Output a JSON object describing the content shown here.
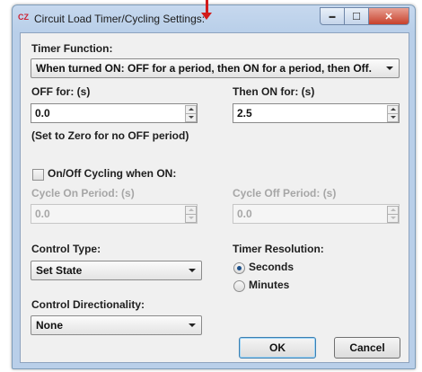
{
  "window": {
    "app_icon": "CZ",
    "title": "Circuit Load Timer/Cycling Settings:"
  },
  "title_buttons": {
    "minimize": "▬",
    "maximize": "☐",
    "close": "✕"
  },
  "timer_function": {
    "label": "Timer Function:",
    "value": "When turned ON: OFF for a period, then ON for a period, then Off."
  },
  "off_for": {
    "label": "OFF for: (s)",
    "value": "0.0",
    "hint": "(Set to Zero for no OFF period)"
  },
  "then_on_for": {
    "label": "Then ON for: (s)",
    "value": "2.5"
  },
  "cycling": {
    "label": "On/Off Cycling when ON:",
    "checked": false
  },
  "cycle_on": {
    "label": "Cycle On Period: (s)",
    "value": "0.0"
  },
  "cycle_off": {
    "label": "Cycle Off Period: (s)",
    "value": "0.0"
  },
  "control_type": {
    "label": "Control Type:",
    "value": "Set State"
  },
  "timer_resolution": {
    "label": "Timer Resolution:",
    "options": [
      "Seconds",
      "Minutes"
    ],
    "selected": "Seconds"
  },
  "control_directionality": {
    "label": "Control Directionality:",
    "value": "None"
  },
  "buttons": {
    "ok": "OK",
    "cancel": "Cancel"
  },
  "annotation": {
    "arrow_color": "#d21a1a"
  }
}
